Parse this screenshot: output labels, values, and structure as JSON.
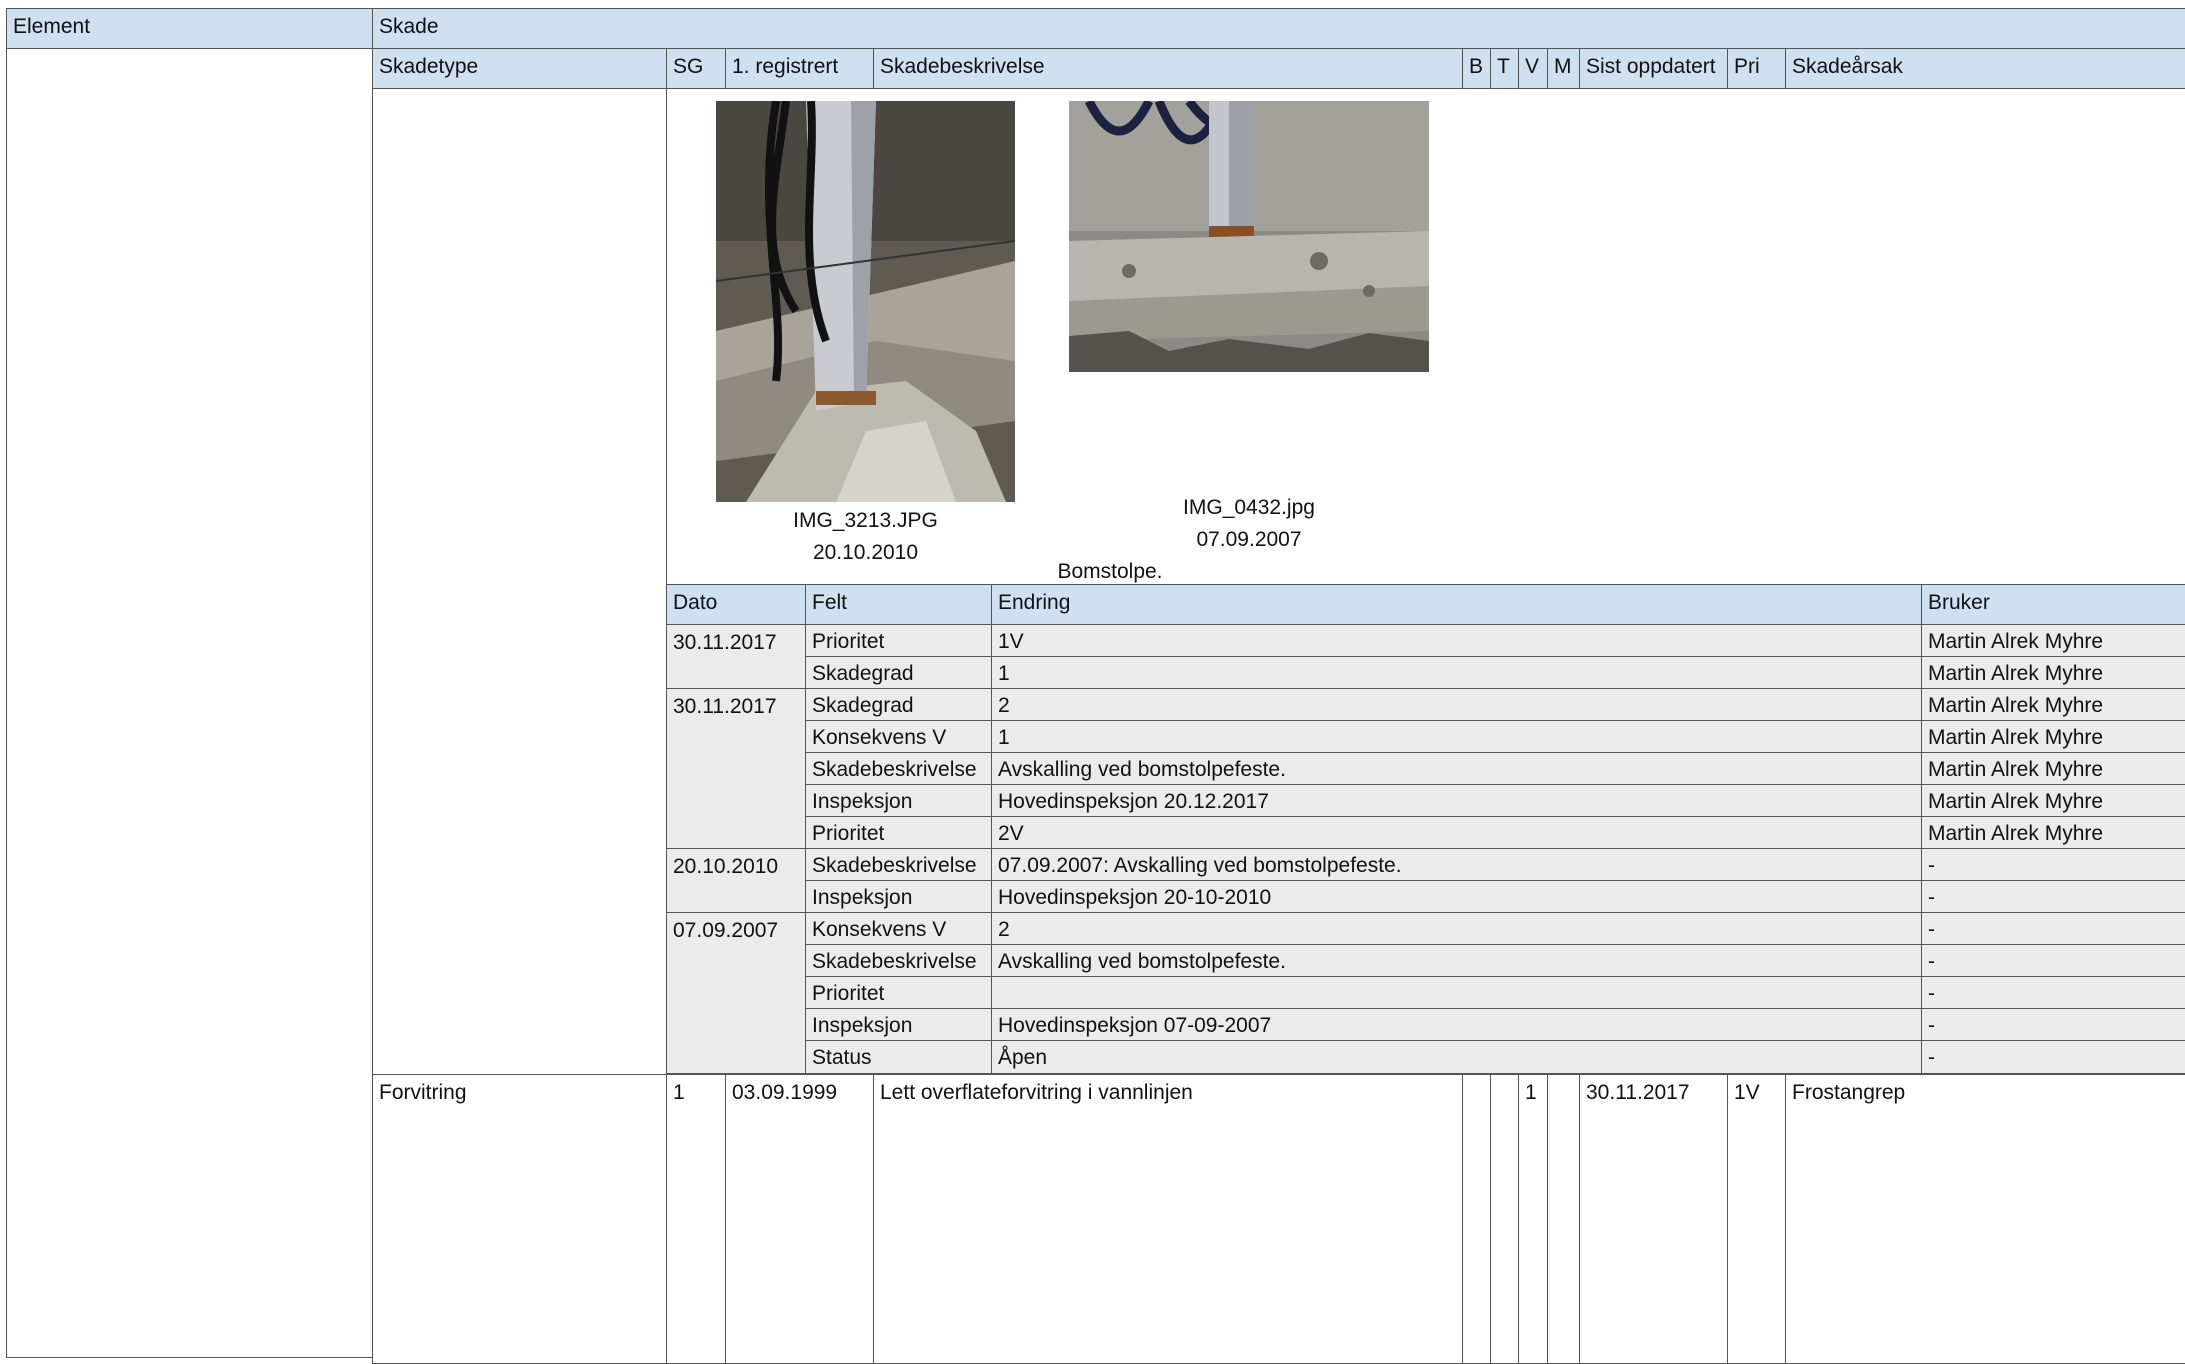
{
  "top_headers": {
    "element": "Element",
    "skade": "Skade"
  },
  "columns": {
    "skadetype": "Skadetype",
    "sg": "SG",
    "registrert": "1. registrert",
    "skadebeskrivelse": "Skadebeskrivelse",
    "b": "B",
    "t": "T",
    "v": "V",
    "m": "M",
    "sist_oppdatert": "Sist oppdatert",
    "pri": "Pri",
    "skadearsak": "Skadeårsak"
  },
  "photos": [
    {
      "filename": "IMG_3213.JPG",
      "date": "20.10.2010"
    },
    {
      "filename": "IMG_0432.jpg",
      "date": "07.09.2007"
    }
  ],
  "photo_caption": "Bomstolpe.",
  "history": {
    "headers": {
      "dato": "Dato",
      "felt": "Felt",
      "endring": "Endring",
      "bruker": "Bruker"
    },
    "groups": [
      {
        "date": "30.11.2017",
        "rows": [
          {
            "felt": "Prioritet",
            "endring": "1V",
            "bruker": "Martin Alrek Myhre"
          },
          {
            "felt": "Skadegrad",
            "endring": "1",
            "bruker": "Martin Alrek Myhre"
          }
        ]
      },
      {
        "date": "30.11.2017",
        "rows": [
          {
            "felt": "Skadegrad",
            "endring": "2",
            "bruker": "Martin Alrek Myhre"
          },
          {
            "felt": "Konsekvens V",
            "endring": "1",
            "bruker": "Martin Alrek Myhre"
          },
          {
            "felt": "Skadebeskrivelse",
            "endring": "Avskalling ved bomstolpefeste.",
            "bruker": "Martin Alrek Myhre"
          },
          {
            "felt": "Inspeksjon",
            "endring": "Hovedinspeksjon 20.12.2017",
            "bruker": "Martin Alrek Myhre"
          },
          {
            "felt": "Prioritet",
            "endring": "2V",
            "bruker": "Martin Alrek Myhre"
          }
        ]
      },
      {
        "date": "20.10.2010",
        "rows": [
          {
            "felt": "Skadebeskrivelse",
            "endring": "07.09.2007: Avskalling ved bomstolpefeste.",
            "bruker": "-"
          },
          {
            "felt": "Inspeksjon",
            "endring": "Hovedinspeksjon 20-10-2010",
            "bruker": "-"
          }
        ]
      },
      {
        "date": "07.09.2007",
        "rows": [
          {
            "felt": "Konsekvens V",
            "endring": "2",
            "bruker": "-"
          },
          {
            "felt": "Skadebeskrivelse",
            "endring": "Avskalling ved bomstolpefeste.",
            "bruker": "-"
          },
          {
            "felt": "Prioritet",
            "endring": "",
            "bruker": "-"
          },
          {
            "felt": "Inspeksjon",
            "endring": "Hovedinspeksjon 07-09-2007",
            "bruker": "-"
          },
          {
            "felt": "Status",
            "endring": "Åpen",
            "bruker": "-"
          }
        ]
      }
    ]
  },
  "damage_row": {
    "skadetype": "Forvitring",
    "sg": "1",
    "registrert": "03.09.1999",
    "skadebeskrivelse": "Lett overflateforvitring i vannlinjen",
    "b": "",
    "t": "",
    "v": "1",
    "m": "",
    "sist_oppdatert": "30.11.2017",
    "pri": "1V",
    "skadearsak": "Frostangrep"
  }
}
